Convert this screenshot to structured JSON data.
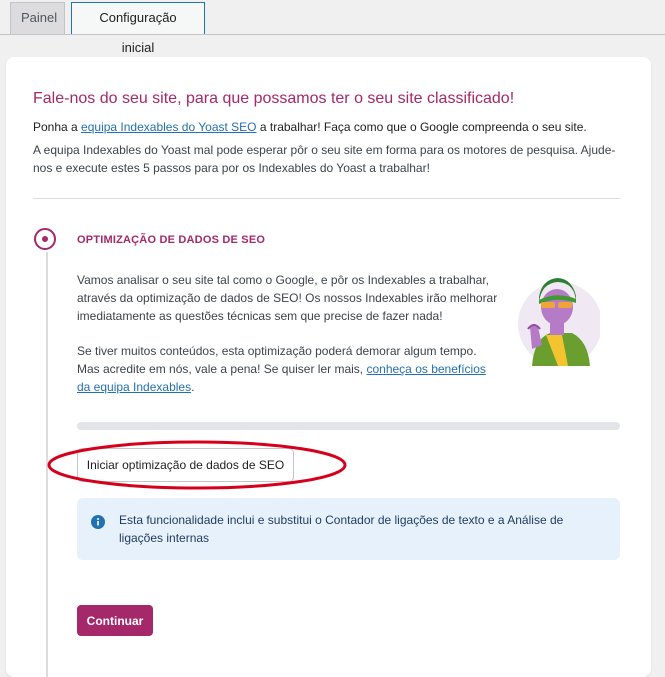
{
  "tabs": [
    {
      "label": "Painel"
    },
    {
      "label": "Configuração inicial"
    }
  ],
  "card": {
    "title": "Fale-nos do seu site, para que possamos ter o seu site classificado!",
    "intro_prefix": "Ponha a ",
    "intro_link": "equipa Indexables do Yoast SEO",
    "intro_suffix": " a trabalhar! Faça como que o Google compreenda o seu site.",
    "intro2": "A equipa Indexables do Yoast mal pode esperar pôr o seu site em forma para os motores de pesquisa. Ajude-nos e execute estes 5 passos para por os Indexables do Yoast a trabalhar!"
  },
  "step": {
    "title": "OPTIMIZAÇÃO DE DADOS DE SEO",
    "desc1": "Vamos analisar o seu site tal como o Google, e pôr os Indexables a trabalhar, através da optimização de dados de SEO! Os nossos Indexables irão melhorar imediatamente as questões técnicas sem que precise de fazer nada!",
    "desc2_prefix": "Se tiver muitos conteúdos, esta optimização poderá demorar algum tempo. Mas acredite em nós, vale a pena! Se quiser ler mais, ",
    "desc2_link": "conheça os benefícios da equipa Indexables",
    "desc2_suffix": ".",
    "progress": 0,
    "button_label": "Iniciar optimização de dados de SEO",
    "info_text": "Esta funcionalidade inclui e substitui o Contador de ligações de texto e a Análise de ligações internas",
    "continue_label": "Continuar"
  },
  "colors": {
    "brand": "#a4286a",
    "link": "#2271b1",
    "info_bg": "#e7f1fc",
    "annotation": "#d6001c"
  },
  "icons": [
    "info-icon",
    "indexable-character-illustration"
  ]
}
